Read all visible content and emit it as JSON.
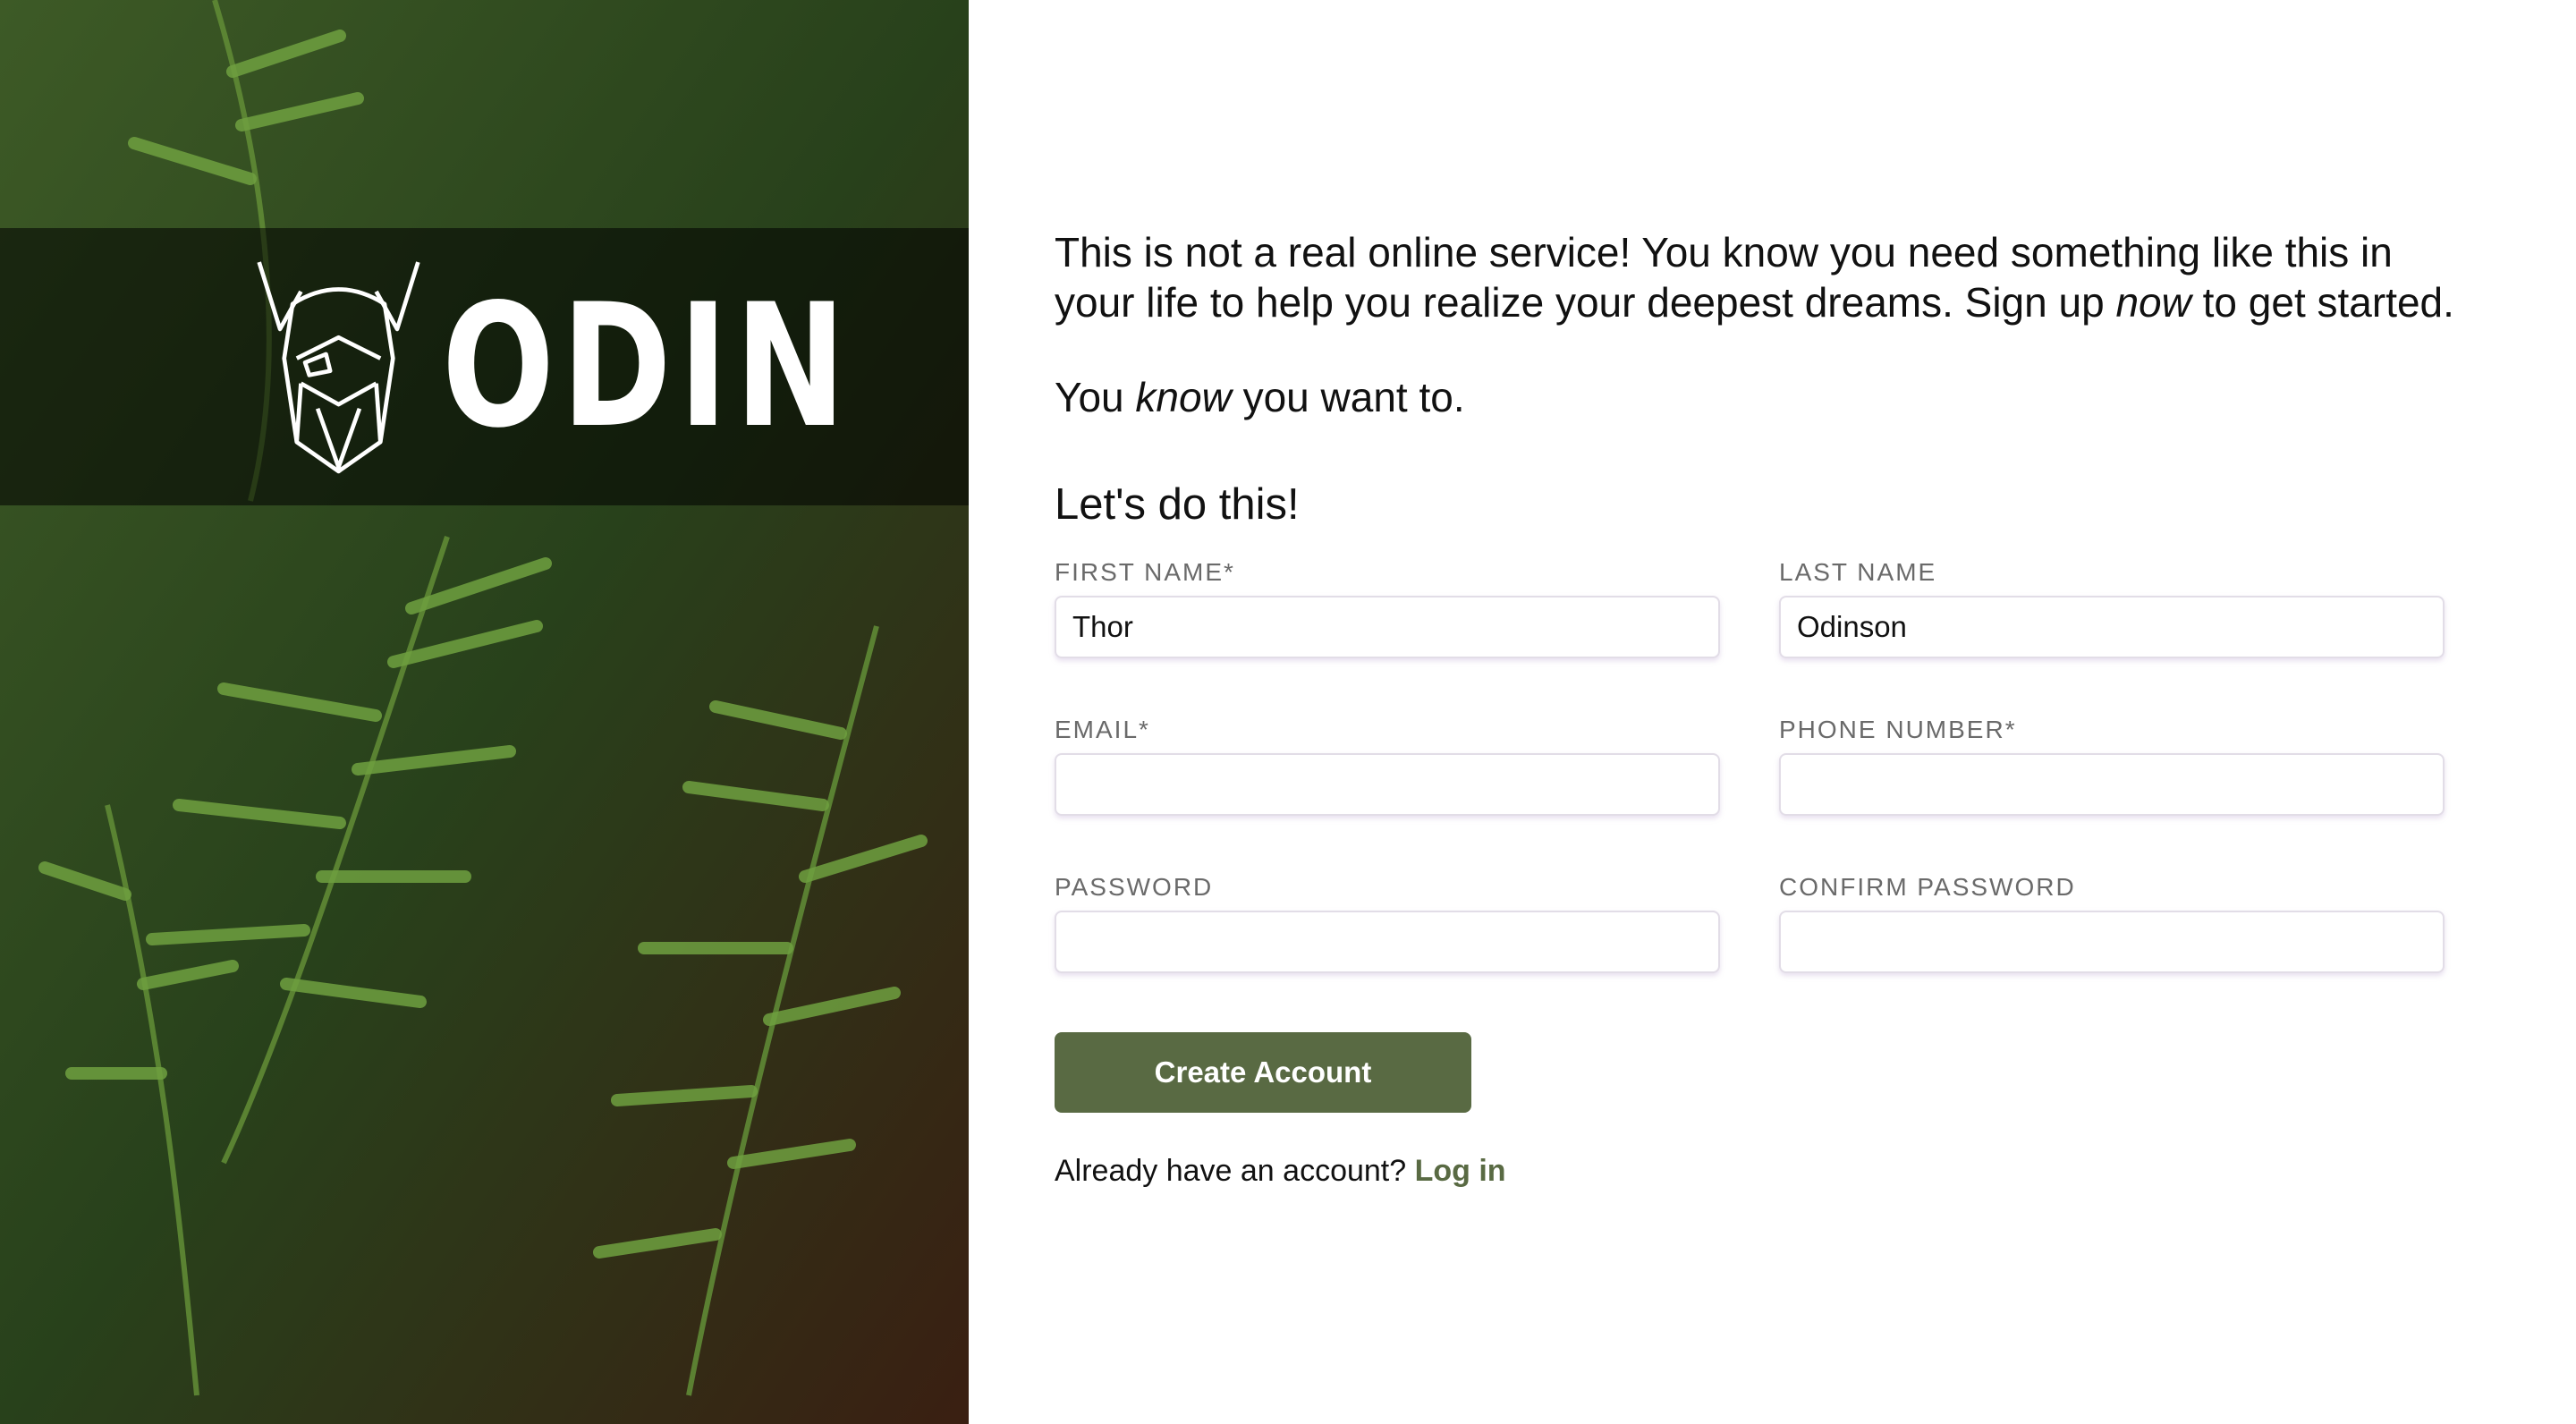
{
  "brand": {
    "wordmark": "ODIN",
    "logo_icon": "viking-head-icon"
  },
  "intro": {
    "part1": "This is not a real online service! You know you need something like this in your life to help you realize your deepest dreams. Sign up ",
    "emphasis": "now",
    "part2": " to get started."
  },
  "intro2": {
    "part1": "You ",
    "emphasis": "know",
    "part2": " you want to."
  },
  "form": {
    "heading": "Let's do this!",
    "first_name": {
      "label": "First Name*",
      "value": "Thor"
    },
    "last_name": {
      "label": "Last Name",
      "value": "Odinson"
    },
    "email": {
      "label": "Email*",
      "value": ""
    },
    "phone": {
      "label": "Phone Number*",
      "value": ""
    },
    "password": {
      "label": "Password",
      "value": ""
    },
    "confirm_password": {
      "label": "Confirm Password",
      "value": ""
    },
    "submit_label": "Create Account"
  },
  "login": {
    "prompt": "Already have an account? ",
    "link_label": "Log in"
  },
  "colors": {
    "accent": "#596a43",
    "input_border": "#e2dde7",
    "label": "#6a6a6a"
  }
}
